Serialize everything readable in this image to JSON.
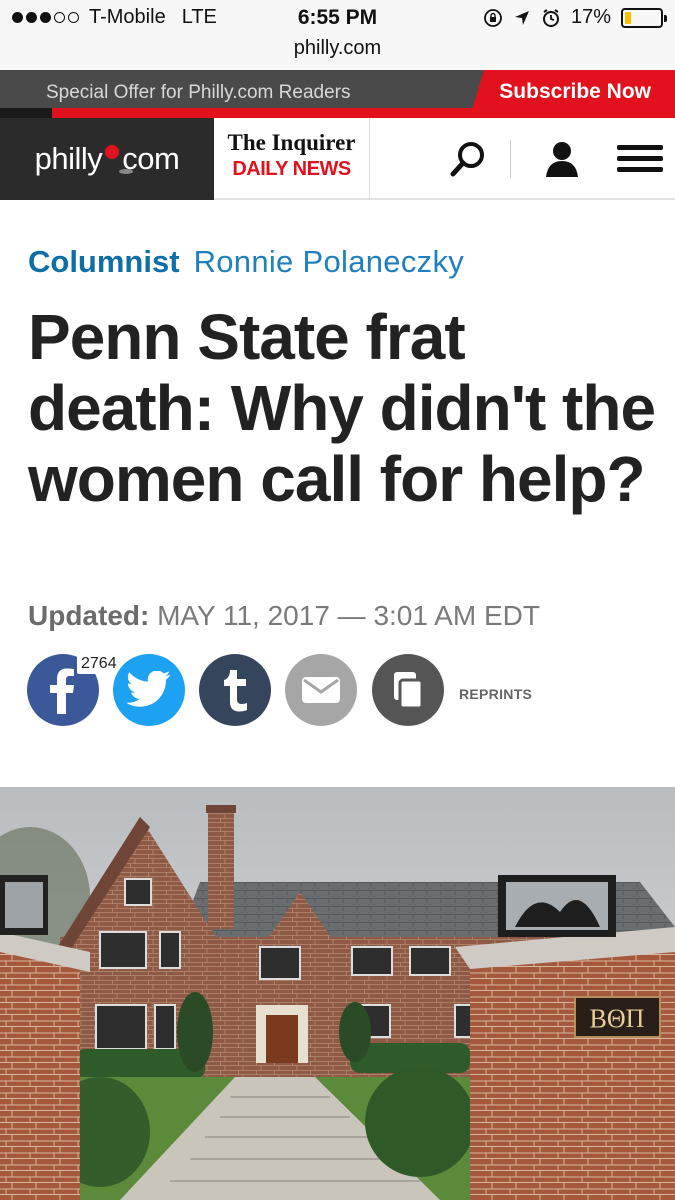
{
  "status_bar": {
    "carrier": "T-Mobile",
    "network": "LTE",
    "time": "6:55 PM",
    "battery": "17%",
    "battery_level": 0.17,
    "url": "philly.com"
  },
  "promo": {
    "text": "Special Offer for Philly.com Readers",
    "subscribe_label": "Subscribe Now"
  },
  "nav": {
    "logo_left": "philly",
    "logo_right": "com",
    "paper_name": "The Inquirer",
    "paper_sub": "DAILY NEWS"
  },
  "article": {
    "category": "Columnist",
    "author": "Ronnie Polaneczky",
    "headline": "Penn State frat death: Why didn't the women call for help?",
    "updated_label": "Updated:",
    "updated_value": "MAY 11, 2017 — 3:01 AM EDT"
  },
  "share": {
    "facebook_count": "2764",
    "reprints_label": "REPRINTS"
  },
  "photo": {
    "sign_text": "ΒΘΠ"
  },
  "colors": {
    "brand_red": "#e1111d",
    "link_blue": "#1f7fbf",
    "facebook": "#3b5998",
    "twitter": "#1da1f2",
    "tumblr": "#35465c"
  }
}
